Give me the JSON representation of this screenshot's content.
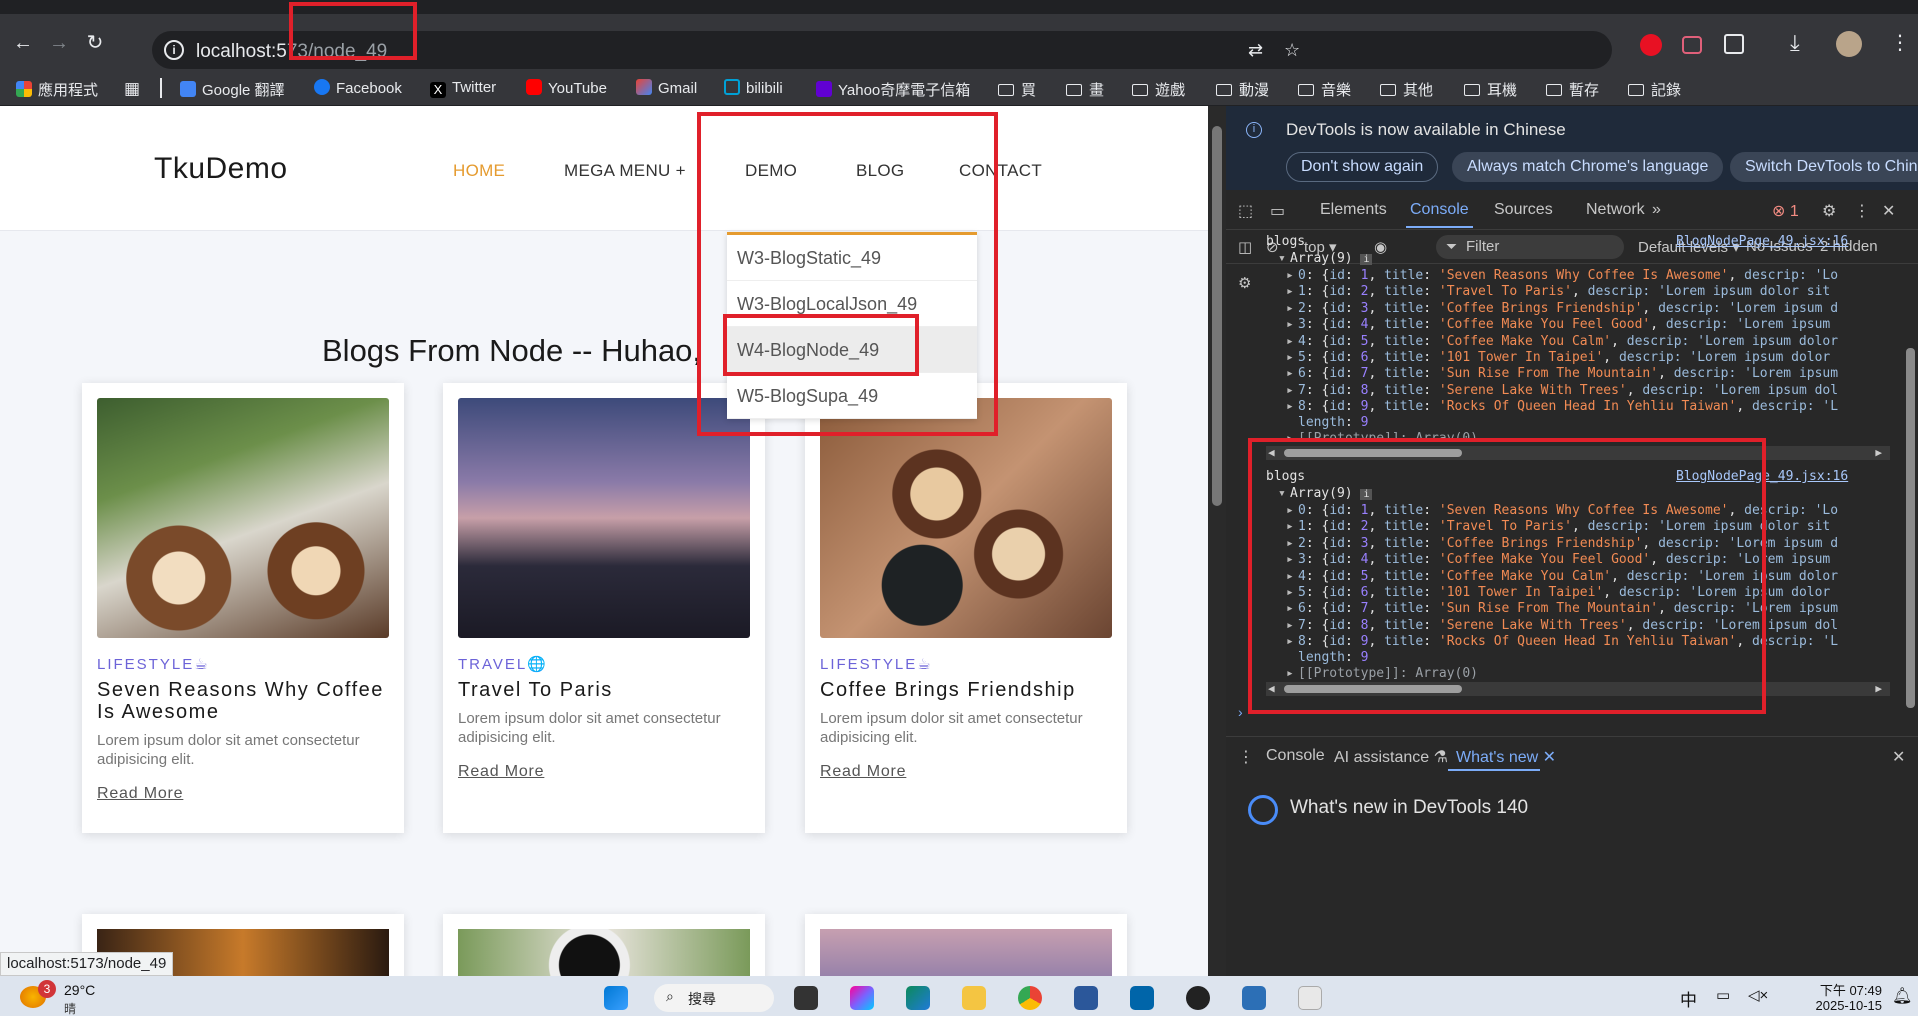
{
  "browser": {
    "url_host": "localhost:5",
    "url_rest": "73/node_49",
    "bookmarks": [
      {
        "label": "應用程式",
        "color": "#e8453c"
      },
      {
        "label": "",
        "color": "#e8eaed"
      },
      {
        "label": "Google 翻譯",
        "color": "#4285f4"
      },
      {
        "label": "Facebook",
        "color": "#1877f2"
      },
      {
        "label": "Twitter",
        "color": "#000000"
      },
      {
        "label": "YouTube",
        "color": "#ff0000"
      },
      {
        "label": "Gmail",
        "color": "#ea4335"
      },
      {
        "label": "bilibili",
        "color": "#00a1d6"
      },
      {
        "label": "Yahoo奇摩電子信箱",
        "color": "#6001d2"
      },
      {
        "label": "買"
      },
      {
        "label": "畫"
      },
      {
        "label": "遊戲"
      },
      {
        "label": "動漫"
      },
      {
        "label": "音樂"
      },
      {
        "label": "其他"
      },
      {
        "label": "耳機"
      },
      {
        "label": "暫存"
      },
      {
        "label": "記錄"
      }
    ],
    "status_url": "localhost:5173/node_49"
  },
  "site": {
    "logo": "TkuDemo",
    "menu": [
      "HOME",
      "MEGA MENU +",
      "DEMO",
      "BLOG",
      "CONTACT"
    ],
    "dropdown": [
      "W3-BlogStatic_49",
      "W3-BlogLocalJson_49",
      "W4-BlogNode_49",
      "W5-BlogSupa_49"
    ],
    "heading": "Blogs From Node -- Huhao,",
    "cards": [
      {
        "category": "LIFESTYLE☕",
        "title": "Seven Reasons Why Coffee Is Awesome",
        "desc": "Lorem ipsum dolor sit amet consectetur adipisicing elit.",
        "more": "Read More"
      },
      {
        "category": "TRAVEL🌐",
        "title": "Travel To Paris",
        "desc": "Lorem ipsum dolor sit amet consectetur adipisicing elit.",
        "more": "Read More"
      },
      {
        "category": "LIFESTYLE☕",
        "title": "Coffee Brings Friendship",
        "desc": "Lorem ipsum dolor sit amet consectetur adipisicing elit.",
        "more": "Read More"
      }
    ],
    "accent": "#e59b2f",
    "category_color": "#6c63d8"
  },
  "devtools": {
    "info": "DevTools is now available in Chinese",
    "pills": [
      "Don't show again",
      "Always match Chrome's language",
      "Switch DevTools to Chine"
    ],
    "tabs": [
      "Elements",
      "Console",
      "Sources",
      "Network"
    ],
    "error_count": "1",
    "context": "top",
    "filter_placeholder": "Filter",
    "levels": "Default levels",
    "issues": "No Issues",
    "hidden": "2 hidden",
    "log_label": "blogs",
    "log_source": "BlogNodePage_49.jsx:16",
    "array_label": "Array(9)",
    "rows": [
      {
        "i": "0",
        "id": "1",
        "title": "'Seven Reasons Why Coffee Is Awesome'",
        "tail": "descrip: 'Lo"
      },
      {
        "i": "1",
        "id": "2",
        "title": "'Travel To Paris'",
        "tail": "descrip: 'Lorem ipsum dolor sit"
      },
      {
        "i": "2",
        "id": "3",
        "title": "'Coffee Brings Friendship'",
        "tail": "descrip: 'Lorem ipsum d"
      },
      {
        "i": "3",
        "id": "4",
        "title": "'Coffee Make You Feel Good'",
        "tail": "descrip: 'Lorem ipsum"
      },
      {
        "i": "4",
        "id": "5",
        "title": "'Coffee Make You Calm'",
        "tail": "descrip: 'Lorem ipsum dolor"
      },
      {
        "i": "5",
        "id": "6",
        "title": "'101 Tower In Taipei'",
        "tail": "descrip: 'Lorem ipsum dolor"
      },
      {
        "i": "6",
        "id": "7",
        "title": "'Sun Rise From The Mountain'",
        "tail": "descrip: 'Lorem ipsum"
      },
      {
        "i": "7",
        "id": "8",
        "title": "'Serene Lake With Trees'",
        "tail": "descrip: 'Lorem ipsum dol"
      },
      {
        "i": "8",
        "id": "9",
        "title": "'Rocks Of Queen Head In Yehliu Taiwan'",
        "tail": "descrip: 'L"
      }
    ],
    "length_label": "length",
    "length_value": "9",
    "prototype": "[[Prototype]]: Array(0)",
    "drawer_tabs": [
      "Console",
      "AI assistance",
      "What's new"
    ],
    "whats_new": "What's new in DevTools 140"
  },
  "taskbar": {
    "badge": "3",
    "temp": "29°C",
    "weather": "晴",
    "search": "搜尋",
    "ime": "中",
    "time": "下午 07:49",
    "date": "2025-10-15"
  }
}
